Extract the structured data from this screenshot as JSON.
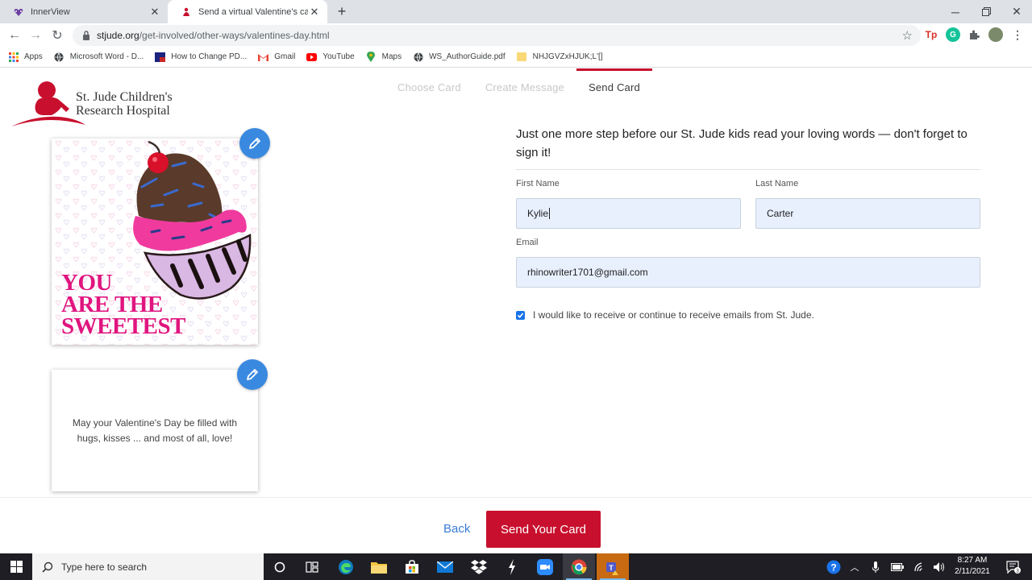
{
  "browser": {
    "tabs": [
      {
        "title": "InnerView",
        "active": false
      },
      {
        "title": "Send a virtual Valentine's card to",
        "active": true
      }
    ],
    "url_host": "stjude.org",
    "url_path": "/get-involved/other-ways/valentines-day.html",
    "bookmarks": [
      "Apps",
      "Microsoft Word - D...",
      "How to Change PD...",
      "Gmail",
      "YouTube",
      "Maps",
      "WS_AuthorGuide.pdf",
      "NHJGVZxHJUK;L'[]"
    ]
  },
  "page": {
    "logo": {
      "line1": "St. Jude Children's",
      "line2": "Research Hospital"
    },
    "steps": [
      "Choose Card",
      "Create Message",
      "Send Card"
    ],
    "active_step": "Send Card",
    "card": {
      "front_text": [
        "YOU",
        "ARE THE",
        "SWEETEST"
      ],
      "inside_message": "May your Valentine's Day be filled with hugs, kisses ... and most of all, love!"
    },
    "form": {
      "lead": "Just one more step before our St. Jude kids read your loving words — don't forget to sign it!",
      "first_name_label": "First Name",
      "first_name_value": "Kylie",
      "last_name_label": "Last Name",
      "last_name_value": "Carter",
      "email_label": "Email",
      "email_value": "rhinowriter1701@gmail.com",
      "optin_label": "I would like to receive or continue to receive emails from St. Jude.",
      "optin_checked": true
    },
    "footer": {
      "back_label": "Back",
      "send_label": "Send Your Card"
    }
  },
  "taskbar": {
    "search_placeholder": "Type here to search",
    "time": "8:27 AM",
    "date": "2/11/2021",
    "notification_count": "3"
  },
  "colors": {
    "brand_red": "#c8102e",
    "link_blue": "#3a7bd5",
    "edit_blue": "#3a89e0",
    "input_bg": "#e8f0fe"
  }
}
